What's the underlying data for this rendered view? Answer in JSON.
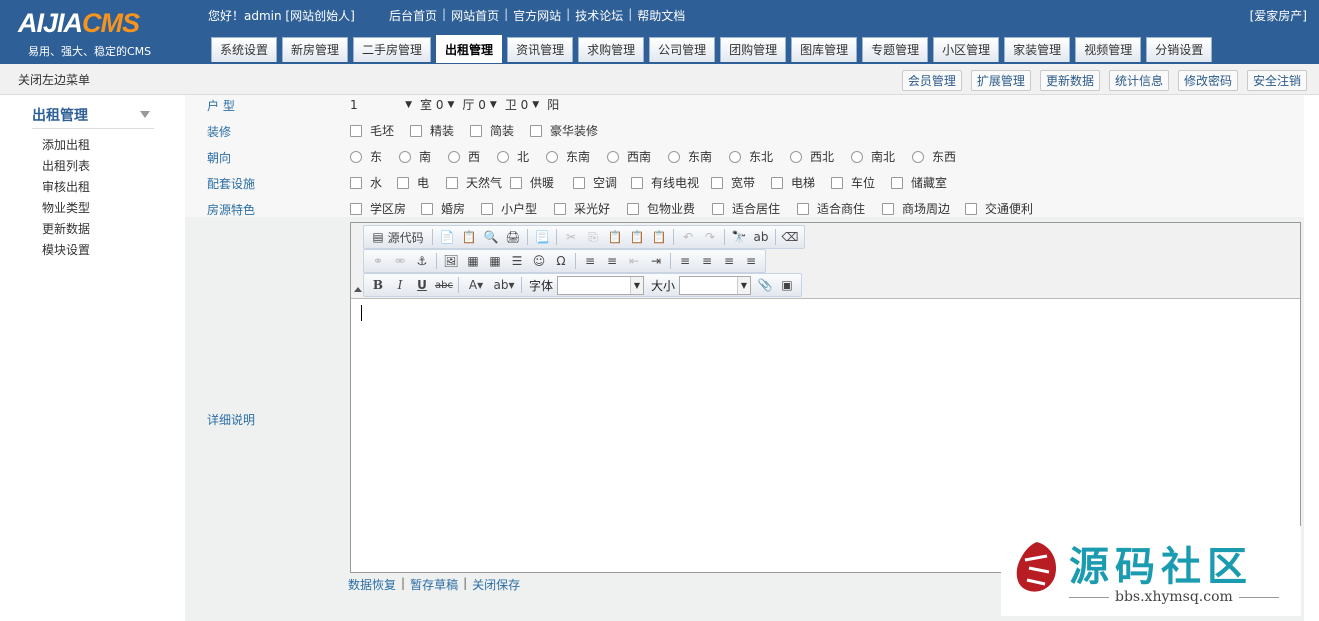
{
  "header": {
    "logo_part1": "AIJIA",
    "logo_part2": "CMS",
    "slogan": "易用、强大、稳定的CMS",
    "welcome": "您好！admin [网站创始人]",
    "top_links": [
      "后台首页",
      "网站首页",
      "官方网站",
      "技术论坛",
      "帮助文档"
    ],
    "brand": "[爱家房产]",
    "tabs": [
      "系统设置",
      "新房管理",
      "二手房管理",
      "出租管理",
      "资讯管理",
      "求购管理",
      "公司管理",
      "团购管理",
      "图库管理",
      "专题管理",
      "小区管理",
      "家装管理",
      "视频管理",
      "分销设置"
    ],
    "active_tab": "出租管理"
  },
  "subbar": {
    "close_left": "关闭左边菜单",
    "buttons": [
      "会员管理",
      "扩展管理",
      "更新数据",
      "统计信息",
      "修改密码",
      "安全注销"
    ]
  },
  "sidebar": {
    "title": "出租管理",
    "items": [
      "添加出租",
      "出租列表",
      "审核出租",
      "物业类型",
      "更新数据",
      "模块设置"
    ]
  },
  "form": {
    "layout_label": "户 型",
    "layout_selects": [
      {
        "prefix": "",
        "value": "1"
      },
      {
        "prefix": "室",
        "value": "0"
      },
      {
        "prefix": "厅",
        "value": "0"
      },
      {
        "prefix": "卫",
        "value": "0"
      }
    ],
    "layout_suffix": "阳",
    "decor_label": "装修",
    "decor_options": [
      "毛坯",
      "精装",
      "简装",
      "豪华装修"
    ],
    "orient_label": "朝向",
    "orient_options": [
      "东",
      "南",
      "西",
      "北",
      "东南",
      "西南",
      "东南",
      "东北",
      "西北",
      "南北",
      "东西"
    ],
    "facility_label": "配套设施",
    "facility_options": [
      "水",
      "电",
      "天然气",
      "供暖",
      "空调",
      "有线电视",
      "宽带",
      "电梯",
      "车位",
      "储藏室"
    ],
    "feature_label": "房源特色",
    "feature_options": [
      "学区房",
      "婚房",
      "小户型",
      "采光好",
      "包物业费",
      "适合居住",
      "适合商住",
      "商场周边",
      "交通便利"
    ],
    "detail_label": "详细说明"
  },
  "editor": {
    "source_label": "源代码",
    "font_label": "字体",
    "size_label": "大小",
    "font_value": "",
    "size_value": "",
    "links": [
      "数据恢复",
      "暂存草稿",
      "关闭保存"
    ]
  },
  "watermark": {
    "title": "源码社区",
    "url": "bbs.xhymsq.com"
  },
  "colors": {
    "header_bg": "#2e5f97",
    "accent_orange": "#f7941d",
    "label_blue": "#2b6ea5",
    "watermark_teal": "#1a9bb0"
  }
}
